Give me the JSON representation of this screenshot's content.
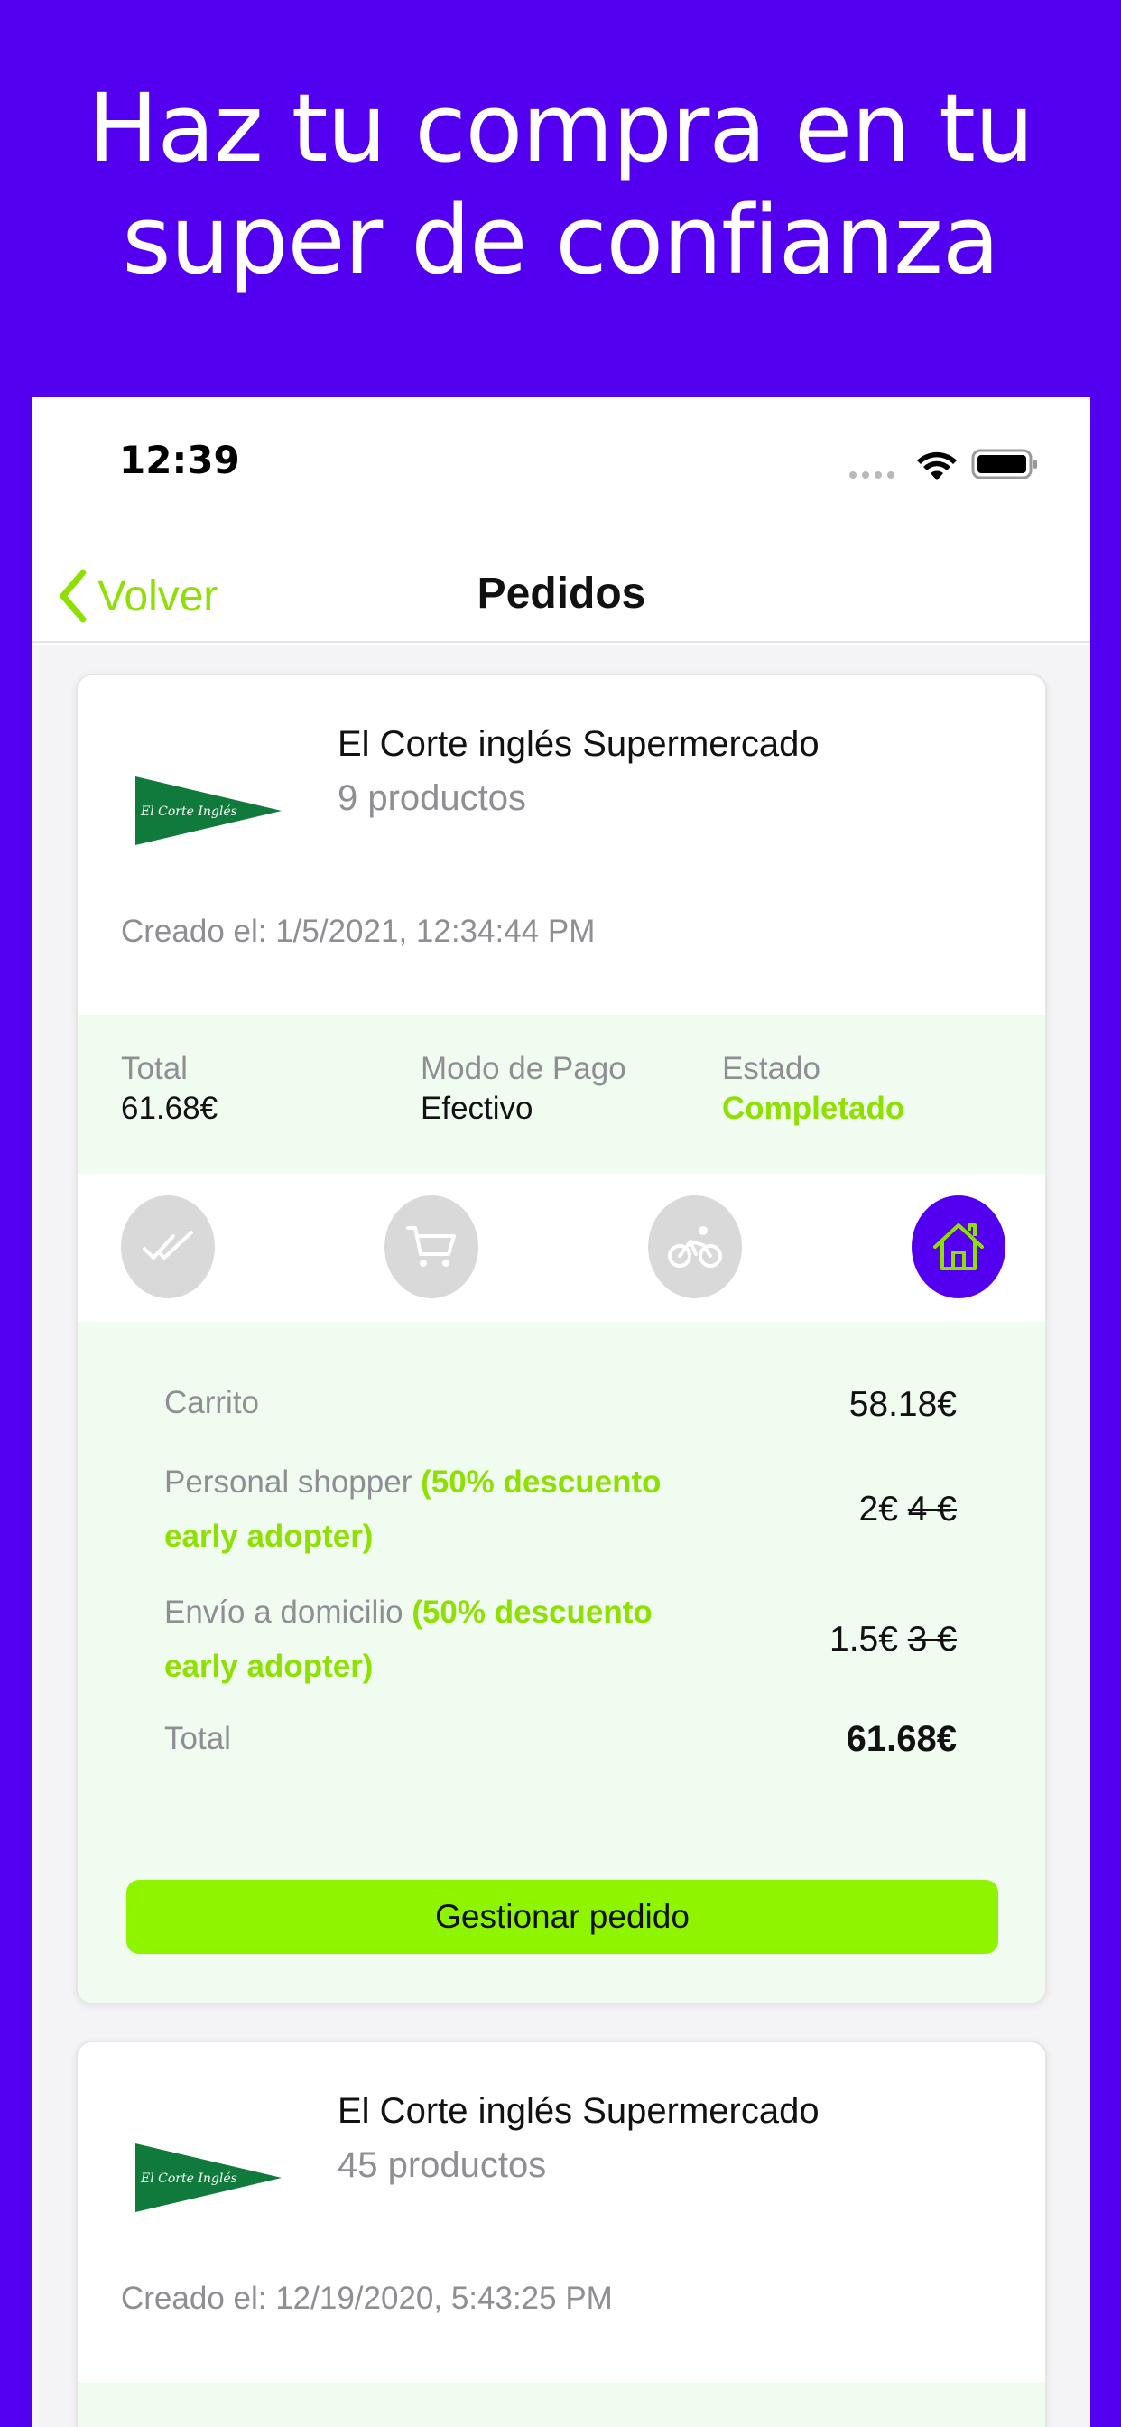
{
  "headline": {
    "line1": "Haz tu compra en tu",
    "line2": "super de confianza"
  },
  "status_bar": {
    "time": "12:39"
  },
  "nav": {
    "back_label": "Volver",
    "title": "Pedidos"
  },
  "orders": [
    {
      "store_name": "El Corte inglés Supermercado",
      "logo": "el-corte-ingles-logo",
      "products": "9 productos",
      "created": "Creado el: 1/5/2021, 12:34:44 PM",
      "total_label": "Total",
      "total_value": "61.68€",
      "payment_label": "Modo de Pago",
      "payment_value": "Efectivo",
      "status_label": "Estado",
      "status_value": "Completado",
      "steps": [
        {
          "icon": "double-check-icon",
          "active": false
        },
        {
          "icon": "cart-icon",
          "active": false
        },
        {
          "icon": "bicycle-icon",
          "active": false
        },
        {
          "icon": "home-icon",
          "active": true
        }
      ],
      "summary": {
        "cart_label": "Carrito",
        "cart_value": "58.18€",
        "shopper_label": "Personal shopper",
        "shopper_discount_a": "(50% descuento",
        "shopper_discount_b": "early adopter)",
        "shopper_value": "2€",
        "shopper_old": "4 €",
        "delivery_label": "Envío a domicilio",
        "delivery_discount_a": "(50% descuento",
        "delivery_discount_b": "early adopter)",
        "delivery_value": "1.5€",
        "delivery_old": "3 €",
        "total_label": "Total",
        "total_value": "61.68€"
      },
      "button_label": "Gestionar pedido"
    },
    {
      "store_name": "El Corte inglés Supermercado",
      "logo": "el-corte-ingles-logo",
      "products": "45 productos",
      "created": "Creado el: 12/19/2020, 5:43:25 PM"
    }
  ],
  "colors": {
    "brand_purple": "#5300f0",
    "accent_green": "#8ee000",
    "button_green": "#8ff400",
    "tint_green": "#f1fcf0"
  }
}
